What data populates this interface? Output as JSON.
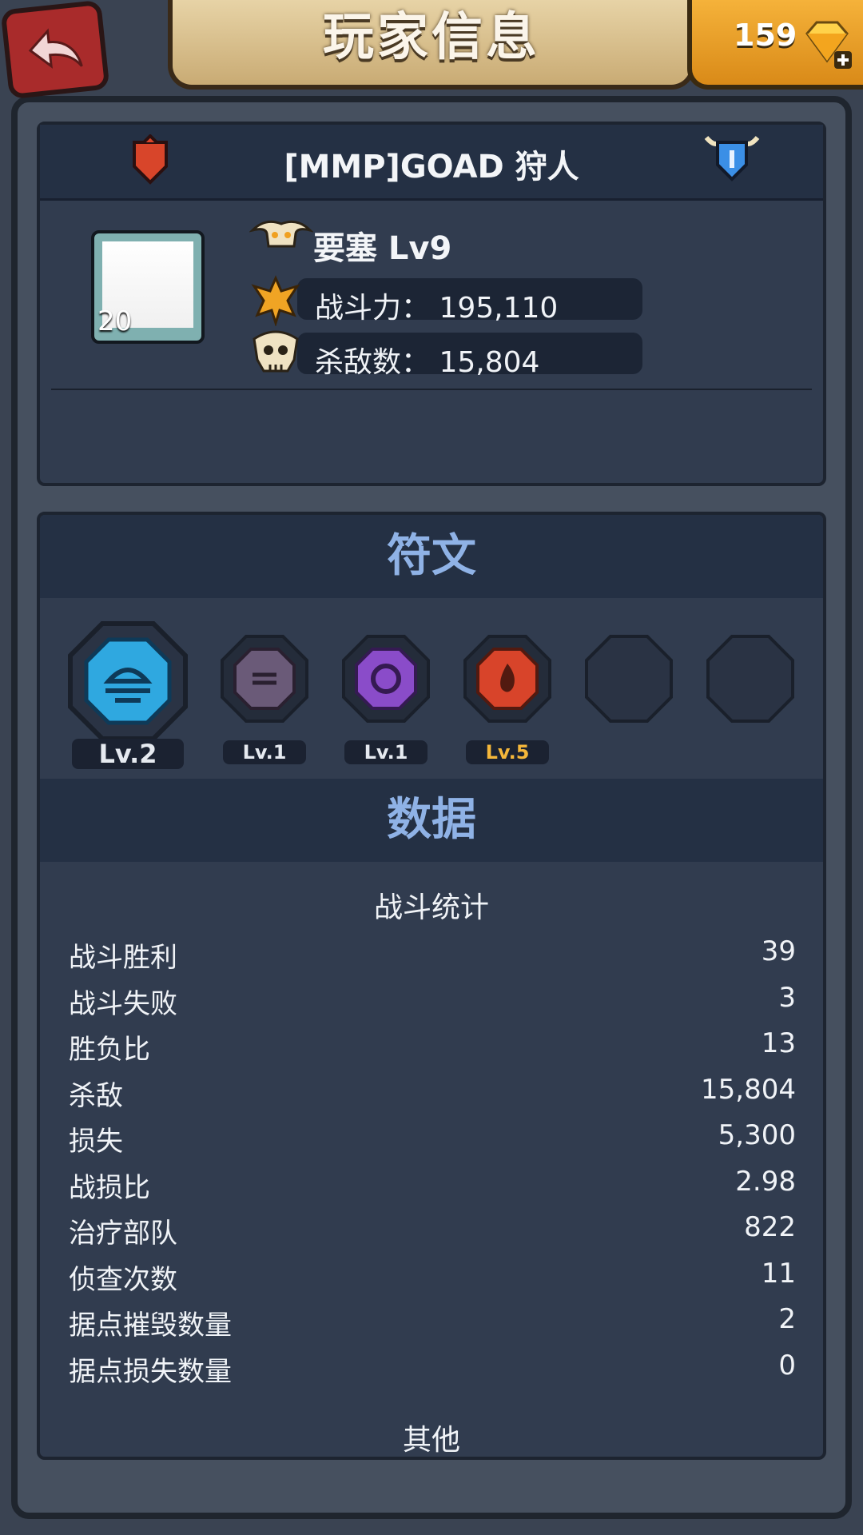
{
  "header": {
    "title": "玩家信息",
    "gems": "159"
  },
  "player": {
    "name": "[MMP]GOAD 狩人",
    "avatar_level": "20",
    "fortress": "要塞 Lv9",
    "power_label": "战斗力：",
    "power_value": "195,110",
    "kills_label": "杀敌数：",
    "kills_value": "15,804"
  },
  "runes": {
    "title": "符文",
    "items": [
      {
        "level": "Lv.2",
        "color": "#2fa8e0"
      },
      {
        "level": "Lv.1",
        "color": "#6a5a78"
      },
      {
        "level": "Lv.1",
        "color": "#8a4cc9"
      },
      {
        "level": "Lv.5",
        "color": "#d8442a"
      }
    ]
  },
  "data": {
    "title": "数据",
    "battle_title": "战斗统计",
    "stats": [
      {
        "label": "战斗胜利",
        "value": "39"
      },
      {
        "label": "战斗失败",
        "value": "3"
      },
      {
        "label": "胜负比",
        "value": "13"
      },
      {
        "label": "杀敌",
        "value": "15,804"
      },
      {
        "label": "损失",
        "value": "5,300"
      },
      {
        "label": "战损比",
        "value": "2.98"
      },
      {
        "label": "治疗部队",
        "value": "822"
      },
      {
        "label": "侦查次数",
        "value": "11"
      },
      {
        "label": "据点摧毁数量",
        "value": "2"
      },
      {
        "label": "据点损失数量",
        "value": "0"
      }
    ],
    "other_title": "其他"
  }
}
